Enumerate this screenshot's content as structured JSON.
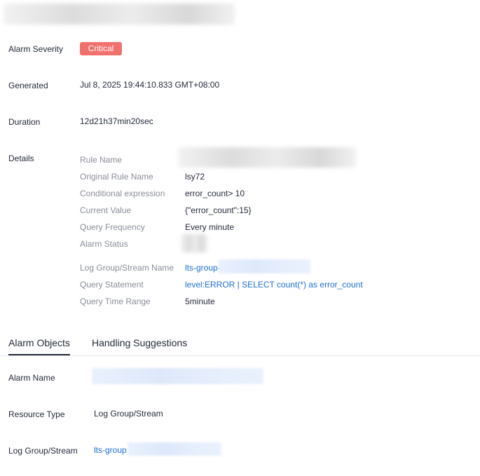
{
  "summary": {
    "severity_label": "Alarm Severity",
    "severity_value": "Critical",
    "generated_label": "Generated",
    "generated_value": "Jul 8, 2025 19:44:10.833 GMT+08:00",
    "duration_label": "Duration",
    "duration_value": "12d21h37min20sec",
    "details_label": "Details"
  },
  "details": {
    "rule_name_label": "Rule Name",
    "original_rule_name_label": "Original Rule Name",
    "original_rule_name_value": "lsy72",
    "conditional_expression_label": "Conditional expression",
    "conditional_expression_value": "error_count> 10",
    "current_value_label": "Current Value",
    "current_value_value": "{\"error_count\":15}",
    "query_frequency_label": "Query Frequency",
    "query_frequency_value": "Every minute",
    "alarm_status_label": "Alarm Status",
    "log_group_stream_name_label": "Log Group/Stream Name",
    "log_group_stream_name_value": "lts-group-",
    "query_statement_label": "Query Statement",
    "query_statement_value": "level:ERROR | SELECT count(*) as error_count",
    "query_time_range_label": "Query Time Range",
    "query_time_range_value": "5minute"
  },
  "tabs": {
    "alarm_objects": "Alarm Objects",
    "handling_suggestions": "Handling Suggestions"
  },
  "objects": {
    "alarm_name_label": "Alarm Name",
    "resource_type_label": "Resource Type",
    "resource_type_value": "Log Group/Stream",
    "log_group_stream_label": "Log Group/Stream",
    "log_group_stream_value": "lts-group"
  },
  "colors": {
    "critical_badge": "#f0706d",
    "link": "#1e6ed8",
    "muted_label": "#8a8e99",
    "text": "#252b3a"
  }
}
